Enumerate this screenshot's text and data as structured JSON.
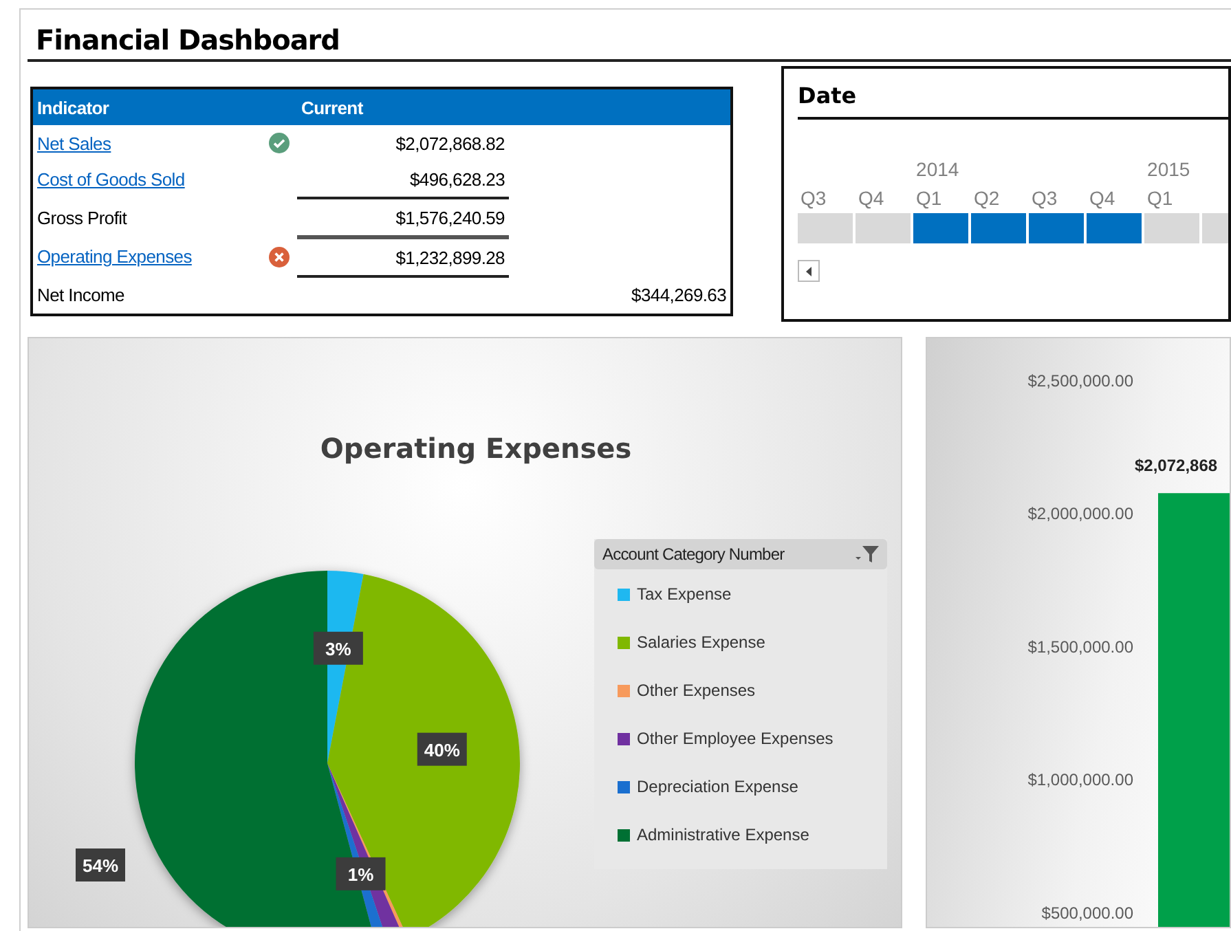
{
  "title": "Financial Dashboard",
  "indicator_table": {
    "columns": [
      "Indicator",
      "Current"
    ],
    "rows": [
      {
        "label": "Net Sales",
        "link": true,
        "target_met": true,
        "current": "$2,072,868.82"
      },
      {
        "label": "Cost of Goods Sold",
        "link": true,
        "current": "$496,628.23",
        "ruled": true
      },
      {
        "label": "Gross Profit",
        "link": false,
        "current": "$1,576,240.59",
        "ruled": true,
        "heavy_rule": true
      },
      {
        "label": "Operating Expenses",
        "link": true,
        "target_met": false,
        "current": "$1,232,899.28",
        "ruled": true
      },
      {
        "label": "Net Income",
        "link": false,
        "column_4": "$344,269.63"
      }
    ]
  },
  "date_slicer": {
    "title": "Date",
    "tiles": [
      {
        "label": "Q3",
        "selected": false
      },
      {
        "label": "Q4",
        "selected": false
      },
      {
        "label": "Q1",
        "year": "2014",
        "selected": true
      },
      {
        "label": "Q2",
        "selected": true
      },
      {
        "label": "Q3",
        "selected": true
      },
      {
        "label": "Q4",
        "selected": true
      },
      {
        "label": "Q1",
        "year": "2015",
        "selected": false
      },
      {
        "selected": false
      }
    ]
  },
  "pie_chart": {
    "legend_title": "Account Category Number",
    "chart_data": {
      "type": "pie",
      "title": "Operating Expenses",
      "categories": [
        "Tax Expense",
        "Salaries Expense",
        "Other Expenses",
        "Other Employee Expenses",
        "Depreciation Expense",
        "Administrative Expense"
      ],
      "colors": [
        "#1fb8f0",
        "#80b800",
        "#f79a5c",
        "#7030a0",
        "#1a6fcf",
        "#007033"
      ],
      "values": [
        3,
        40,
        0.3,
        1.4,
        1,
        54
      ],
      "value_labels": [
        "3%",
        "40%",
        null,
        null,
        "1%",
        "54%"
      ]
    }
  },
  "bar_chart": {
    "chart_data": {
      "type": "bar",
      "series": [
        {
          "color": "#00a04a",
          "values": [
            2072869
          ]
        }
      ],
      "ylim": [
        500000,
        2500000
      ],
      "yticks": [
        {
          "value": 2500000,
          "label": "$2,500,000.00"
        },
        {
          "value": 2000000,
          "label": "$2,000,000.00"
        },
        {
          "value": 1500000,
          "label": "$1,500,000.00"
        },
        {
          "value": 1000000,
          "label": "$1,000,000.00"
        },
        {
          "value": 500000,
          "label": "$500,000.00"
        }
      ],
      "value_labels": [
        "$2,072,868"
      ]
    }
  }
}
